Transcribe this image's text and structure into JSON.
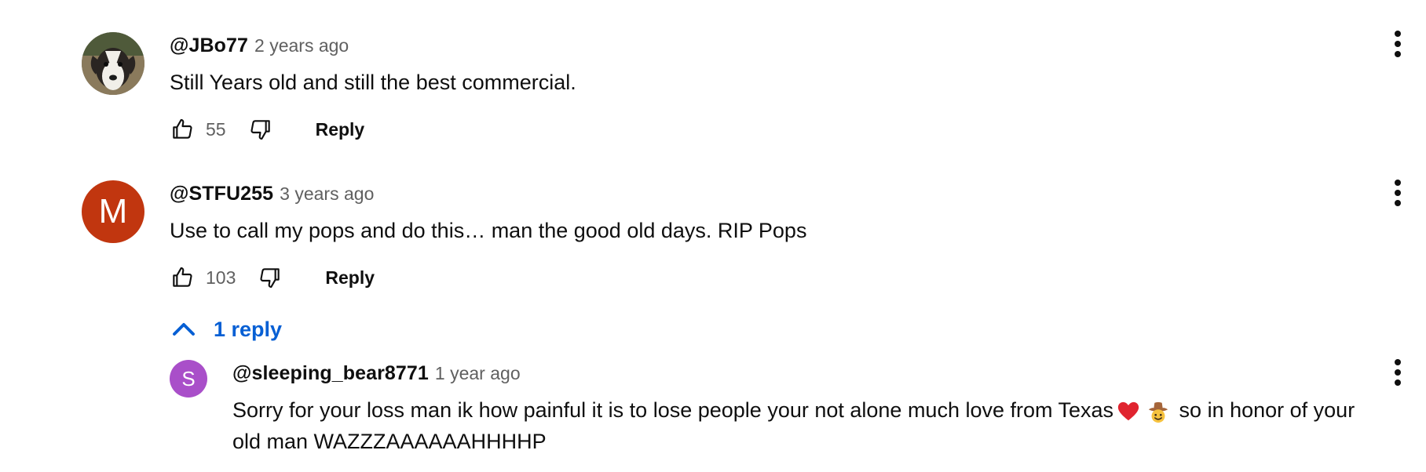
{
  "comments": [
    {
      "author": "@JBo77",
      "time": "2 years ago",
      "text": "Still Years old and still the best commercial.",
      "likes": "55",
      "reply_label": "Reply",
      "avatar_kind": "photo-dog"
    },
    {
      "author": "@STFU255",
      "time": "3 years ago",
      "text": "Use to call my pops and do this… man the good old days. RIP Pops",
      "likes": "103",
      "reply_label": "Reply",
      "avatar_letter": "M",
      "avatar_color": "#c1360f"
    }
  ],
  "replies_toggle": {
    "label": "1 reply",
    "color": "#065fd4"
  },
  "reply": {
    "author": "@sleeping_bear8771",
    "time": "1 year ago",
    "text_line1_a": "Sorry for your loss man ik how painful it is to lose people your not alone much love from Texas",
    "text_line1_b": " so in honor of your",
    "text_line2": "old man WAZZZAAAAAAHHHHP",
    "emojis": [
      "red-heart",
      "cowboy-face"
    ],
    "avatar_letter": "S",
    "avatar_color": "#a94fc9"
  }
}
